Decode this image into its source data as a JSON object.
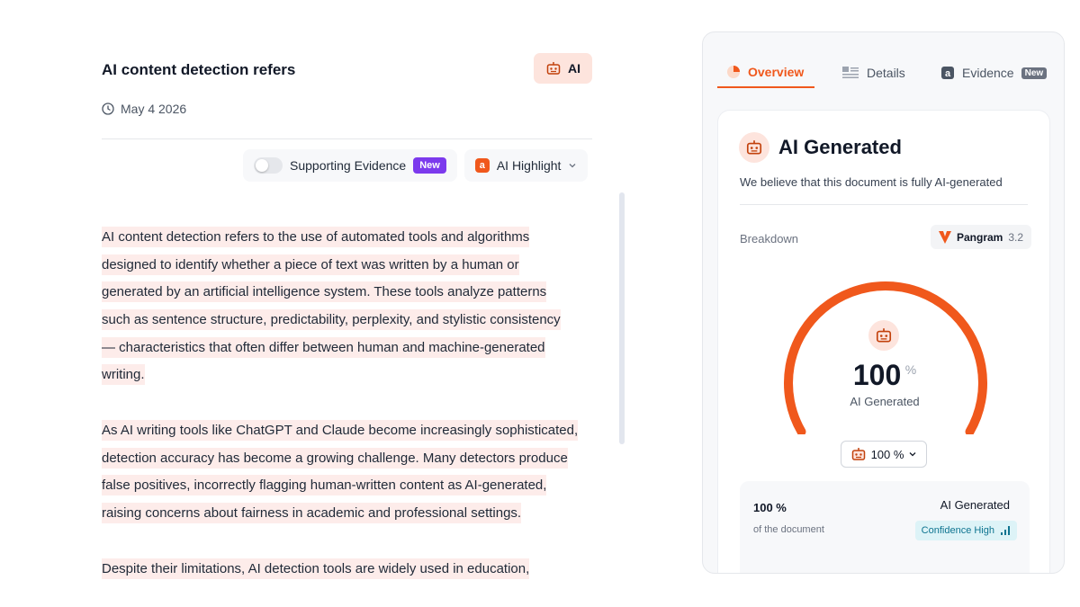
{
  "document": {
    "title": "AI content detection refers",
    "badge_label": "AI",
    "date": "May 4 2026",
    "toolbar": {
      "supporting_evidence_label": "Supporting Evidence",
      "new_tag": "New",
      "highlight_label": "AI Highlight",
      "highlight_icon_letter": "a"
    },
    "paragraphs": [
      [
        "AI content detection refers to the use of automated tools and algorithms",
        "designed to identify whether a piece of text was written by a human or",
        "generated by an artificial intelligence system. These tools analyze patterns",
        "such as sentence structure, predictability, perplexity, and stylistic consistency",
        "— characteristics that often differ between human and machine-generated",
        "writing."
      ],
      [
        "As AI writing tools like ChatGPT and Claude become increasingly sophisticated,",
        "detection accuracy has become a growing challenge. Many detectors produce",
        "false positives, incorrectly flagging human-written content as AI-generated,",
        "raising concerns about fairness in academic and professional settings."
      ],
      [
        "Despite their limitations, AI detection tools are widely used in education,"
      ]
    ]
  },
  "panel": {
    "tabs": [
      {
        "label": "Overview",
        "icon": "overview-icon"
      },
      {
        "label": "Details",
        "icon": "details-icon"
      },
      {
        "label": "Evidence",
        "icon": "evidence-icon",
        "tag": "New"
      }
    ],
    "result_title": "AI Generated",
    "result_desc": "We believe that this document is fully AI-generated",
    "breakdown_label": "Breakdown",
    "model_name": "Pangram",
    "model_version": "3.2",
    "gauge_value": "100",
    "gauge_unit": "%",
    "gauge_fraction": 1.0,
    "gauge_caption": "AI Generated",
    "dropdown_value": "100 %",
    "summary": {
      "percent": "100 %",
      "percent_sub": "of the document",
      "label": "AI Generated",
      "confidence": "Confidence High"
    },
    "colors": {
      "accent": "#f0581c",
      "highlight": "#fdecea",
      "badge_bg": "#fde4dd",
      "new_tag": "#7c3aed"
    }
  }
}
